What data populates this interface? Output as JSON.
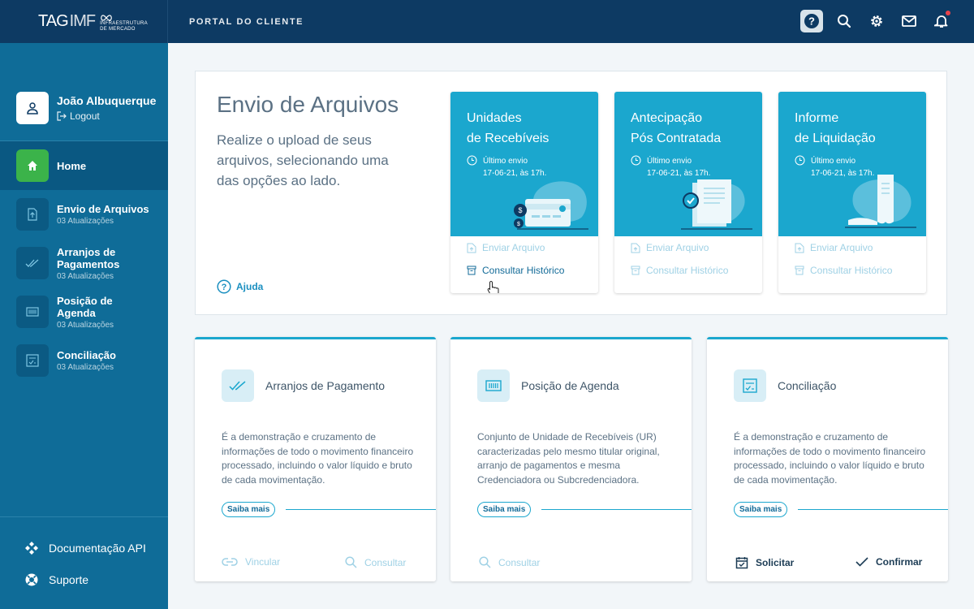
{
  "header": {
    "logo_main": "TAG",
    "logo_imf": "IMF",
    "logo_sub_1": "INFRAESTRUTURA",
    "logo_sub_2": "DE MERCADO",
    "portal": "PORTAL DO CLIENTE",
    "icons": [
      "help-icon",
      "search-icon",
      "gear-icon",
      "mail-icon",
      "bell-icon"
    ],
    "notification_color": "#e8434b"
  },
  "user": {
    "name": "João Albuquerque",
    "logout": "Logout"
  },
  "sidebar": {
    "items": [
      {
        "label": "Home",
        "sub": "",
        "icon": "home-icon"
      },
      {
        "label": "Envio de Arquivos",
        "sub": "03 Atualizações",
        "icon": "upload-file-icon"
      },
      {
        "label": "Arranjos de Pagamentos",
        "sub": "03 Atualizações",
        "icon": "double-check-icon"
      },
      {
        "label": "Posição de Agenda",
        "sub": "03 Atualizações",
        "icon": "barcode-icon"
      },
      {
        "label": "Conciliação",
        "sub": "03 Atualizações",
        "icon": "checklist-icon"
      }
    ],
    "bottom": [
      {
        "label": "Documentação API",
        "icon": "api-icon"
      },
      {
        "label": "Suporte",
        "icon": "lifebuoy-icon"
      }
    ]
  },
  "upload": {
    "title": "Envio de Arquivos",
    "desc": "Realize o upload de seus arquivos, selecionando uma das opções ao lado.",
    "help": "Ajuda",
    "cards": [
      {
        "title_1": "Unidades",
        "title_2": "de Recebíveis",
        "last_1": "Último envio",
        "last_2": "17-06-21, às 17h.",
        "send": "Enviar Arquivo",
        "history": "Consultar Histórico"
      },
      {
        "title_1": "Antecipação",
        "title_2": "Pós Contratada",
        "last_1": "Último envio",
        "last_2": "17-06-21, às 17h.",
        "send": "Enviar Arquivo",
        "history": "Consultar Histórico"
      },
      {
        "title_1": "Informe",
        "title_2": "de Liquidação",
        "last_1": "Último envio",
        "last_2": "17-06-21, às 17h.",
        "send": "Enviar Arquivo",
        "history": "Consultar Histórico"
      }
    ]
  },
  "cards": [
    {
      "title": "Arranjos de Pagamento",
      "desc": "É a demonstração e cruzamento de informações de todo o movimento financeiro processado, incluindo o valor líquido e bruto de cada movimentação.",
      "more": "Saiba mais",
      "act1": "Vincular",
      "act2": "Consultar"
    },
    {
      "title": "Posição de Agenda",
      "desc": "Conjunto de Unidade de Recebíveis (UR) caracterizadas pelo mesmo titular original, arranjo de pagamentos e mesma Credenciadora ou Subcredenciadora.",
      "more": "Saiba mais",
      "act1": "Consultar"
    },
    {
      "title": "Conciliação",
      "desc": "É a demonstração e cruzamento de informações de todo o movimento financeiro processado, incluindo o valor líquido e bruto de cada movimentação.",
      "more": "Saiba mais",
      "act1": "Solicitar",
      "act2": "Confirmar"
    }
  ],
  "colors": {
    "topbar": "#0d3a63",
    "sidebar": "#0f6c98",
    "accent": "#1ba7ce",
    "home_active": "#3bb34a"
  }
}
